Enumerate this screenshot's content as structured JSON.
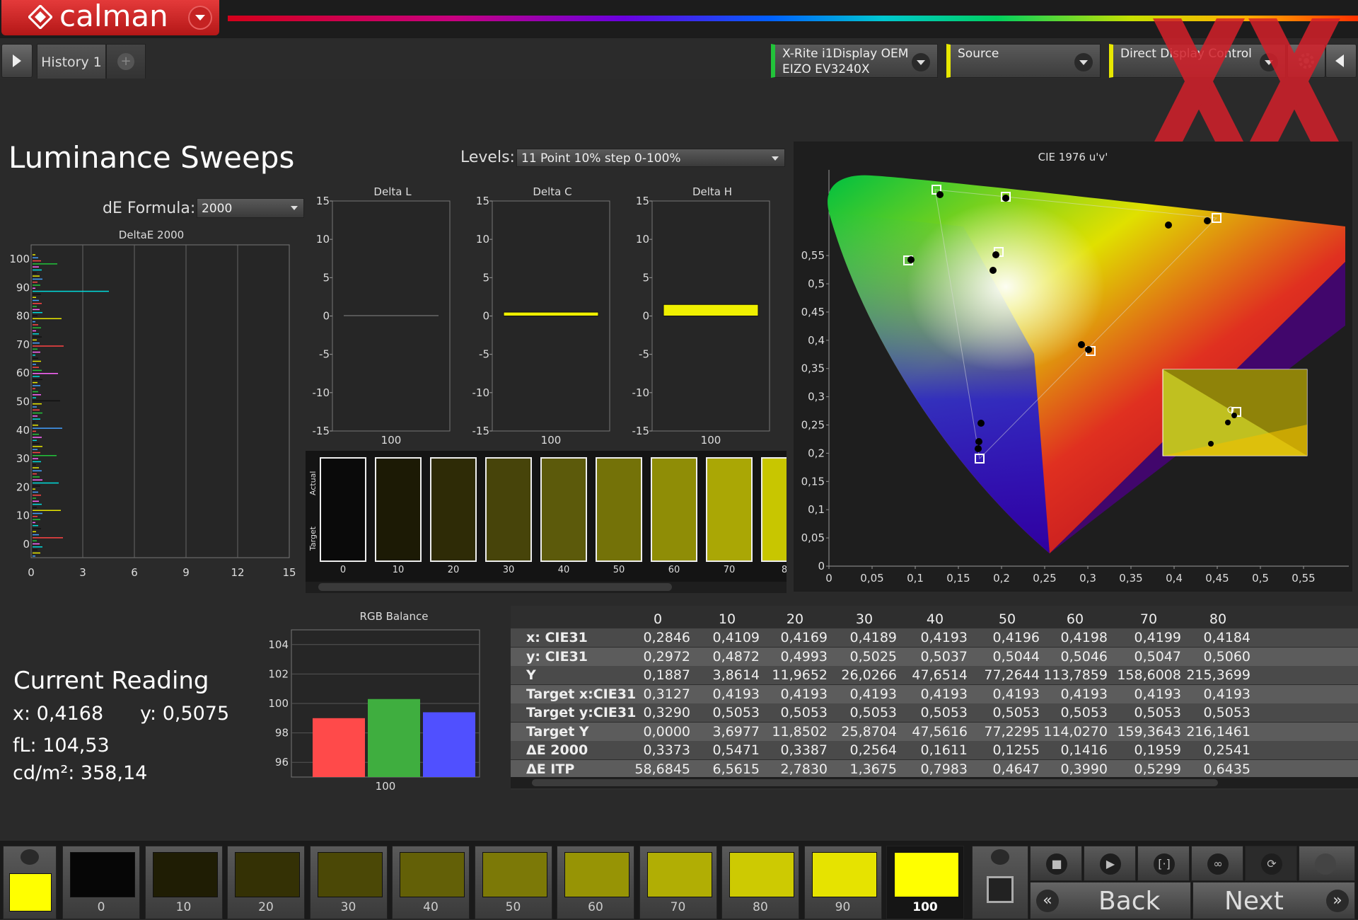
{
  "app": {
    "name": "calman"
  },
  "tabs": {
    "history": "History 1",
    "add": "+"
  },
  "devices": [
    {
      "line1": "X-Rite i1Display OEM",
      "line2": "EIZO EV3240X",
      "color": "#22c43a"
    },
    {
      "line1": "Source",
      "line2": "",
      "color": "#e8e800"
    },
    {
      "line1": "Direct Display Control",
      "line2": "",
      "color": "#e8e800"
    }
  ],
  "page": {
    "title": "Luminance Sweeps",
    "levels_label": "Levels:",
    "levels_value": "11 Point 10% step 0-100%",
    "de_formula_label": "dE Formula:",
    "de_formula_value": "2000"
  },
  "charts": {
    "deltae": {
      "title": "DeltaE 2000",
      "y_ticks": [
        "100",
        "90",
        "80",
        "70",
        "60",
        "50",
        "40",
        "30",
        "20",
        "10",
        "0"
      ],
      "x_ticks": [
        "0",
        "3",
        "6",
        "9",
        "12",
        "15"
      ]
    },
    "delta_l": {
      "title": "Delta L",
      "y_ticks": [
        "15",
        "10",
        "5",
        "0",
        "-5",
        "-10",
        "-15"
      ],
      "x_label": "100",
      "value": 0.0
    },
    "delta_c": {
      "title": "Delta C",
      "y_ticks": [
        "15",
        "10",
        "5",
        "0",
        "-5",
        "-10",
        "-15"
      ],
      "x_label": "100",
      "value": 0.5
    },
    "delta_h": {
      "title": "Delta H",
      "y_ticks": [
        "15",
        "10",
        "5",
        "0",
        "-5",
        "-10",
        "-15"
      ],
      "x_label": "100",
      "value": 1.5
    },
    "rgb": {
      "title": "RGB Balance",
      "y_ticks": [
        "104",
        "102",
        "100",
        "98",
        "96"
      ],
      "x_label": "100",
      "values": {
        "r": 99.0,
        "g": 100.3,
        "b": 99.4
      }
    },
    "cie": {
      "title": "CIE 1976 u'v'",
      "y_ticks": [
        "0,55",
        "0,5",
        "0,45",
        "0,4",
        "0,35",
        "0,3",
        "0,25",
        "0,2",
        "0,15",
        "0,1",
        "0,05",
        "0"
      ],
      "x_ticks": [
        "0",
        "0,05",
        "0,1",
        "0,15",
        "0,2",
        "0,25",
        "0,3",
        "0,35",
        "0,4",
        "0,45",
        "0,5",
        "0,55"
      ]
    }
  },
  "swatch_strip": {
    "actual_label": "Actual",
    "target_label": "Target",
    "levels": [
      "0",
      "10",
      "20",
      "30",
      "40",
      "50",
      "60",
      "70",
      "8"
    ],
    "colors": [
      "#0a0a0a",
      "#1c1a05",
      "#2e2b06",
      "#47440a",
      "#5c5a0b",
      "#747208",
      "#8f8d06",
      "#aaa705",
      "#c8c600"
    ]
  },
  "table": {
    "columns": [
      "0",
      "10",
      "20",
      "30",
      "40",
      "50",
      "60",
      "70",
      "80"
    ],
    "rows": [
      {
        "label": "x: CIE31",
        "values": [
          "0,2846",
          "0,4109",
          "0,4169",
          "0,4189",
          "0,4193",
          "0,4196",
          "0,4198",
          "0,4199",
          "0,4184"
        ]
      },
      {
        "label": "y: CIE31",
        "values": [
          "0,2972",
          "0,4872",
          "0,4993",
          "0,5025",
          "0,5037",
          "0,5044",
          "0,5046",
          "0,5047",
          "0,5060"
        ]
      },
      {
        "label": "Y",
        "values": [
          "0,1887",
          "3,8614",
          "11,9652",
          "26,0266",
          "47,6514",
          "77,2644",
          "113,7859",
          "158,6008",
          "215,3699"
        ]
      },
      {
        "label": "Target x:CIE31",
        "values": [
          "0,3127",
          "0,4193",
          "0,4193",
          "0,4193",
          "0,4193",
          "0,4193",
          "0,4193",
          "0,4193",
          "0,4193"
        ]
      },
      {
        "label": "Target y:CIE31",
        "values": [
          "0,3290",
          "0,5053",
          "0,5053",
          "0,5053",
          "0,5053",
          "0,5053",
          "0,5053",
          "0,5053",
          "0,5053"
        ]
      },
      {
        "label": "Target Y",
        "values": [
          "0,0000",
          "3,6977",
          "11,8502",
          "25,8704",
          "47,5616",
          "77,2295",
          "114,0270",
          "159,3643",
          "216,1461"
        ]
      },
      {
        "label": "ΔE 2000",
        "values": [
          "0,3373",
          "0,5471",
          "0,3387",
          "0,2564",
          "0,1611",
          "0,1255",
          "0,1416",
          "0,1959",
          "0,2541"
        ]
      },
      {
        "label": "ΔE ITP",
        "values": [
          "58,6845",
          "6,5615",
          "2,7830",
          "1,3675",
          "0,7983",
          "0,4647",
          "0,3990",
          "0,5299",
          "0,6435"
        ]
      }
    ]
  },
  "current_reading": {
    "title": "Current Reading",
    "x": "x: 0,4168",
    "y": "y: 0,5075",
    "fl": "fL: 104,53",
    "cd": "cd/m²: 358,14"
  },
  "bottom_swatches": {
    "levels": [
      "0",
      "10",
      "20",
      "30",
      "40",
      "50",
      "60",
      "70",
      "80",
      "90",
      "100"
    ],
    "colors": [
      "#060606",
      "#1f1d04",
      "#343105",
      "#4b4806",
      "#636007",
      "#7c7907",
      "#979405",
      "#b1ae04",
      "#cdca02",
      "#e6e300",
      "#ffff00"
    ],
    "current_color": "#ffff00"
  },
  "nav": {
    "back": "Back",
    "next": "Next"
  }
}
